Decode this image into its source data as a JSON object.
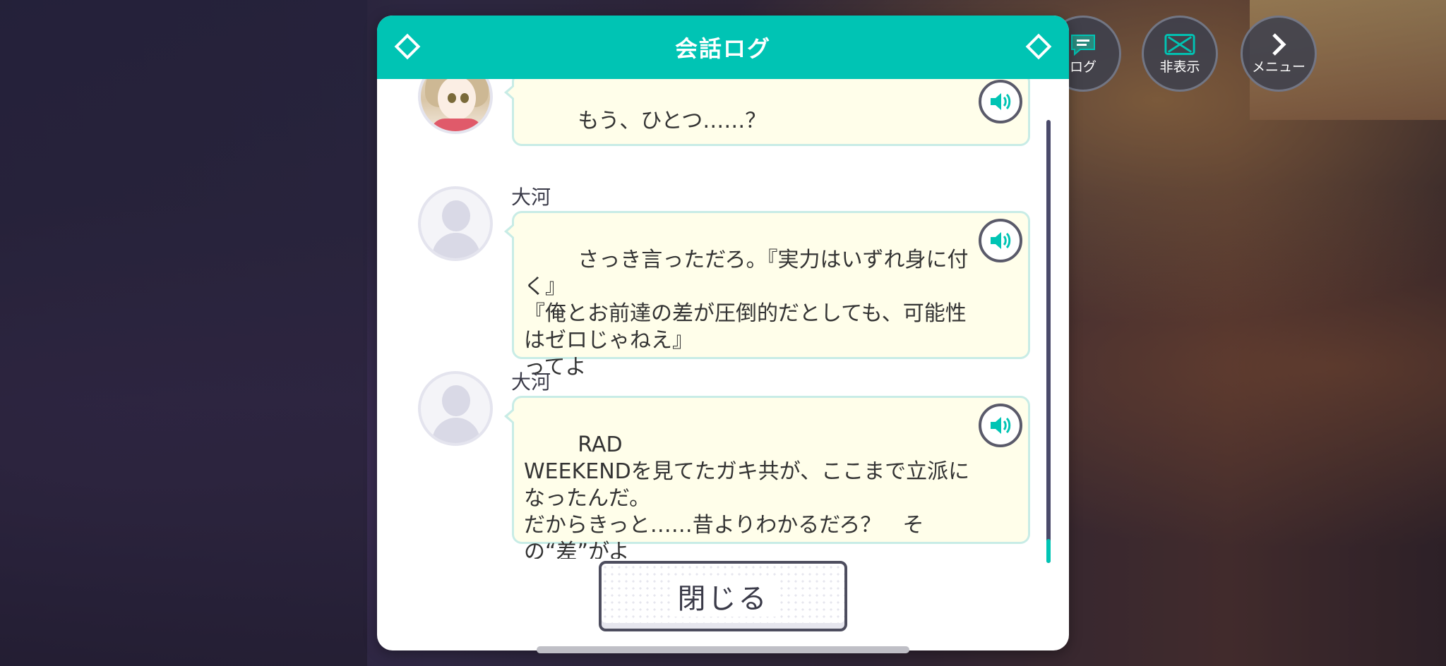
{
  "dialog": {
    "title": "会話ログ",
    "close_label": "閉じる"
  },
  "hud": {
    "log_label": "ログ",
    "hide_label": "非表示",
    "menu_label": "メニュー"
  },
  "entries": [
    {
      "speaker": "",
      "text": "もう、ひとつ……？",
      "avatar": "girl"
    },
    {
      "speaker": "大河",
      "text": "さっき言っただろ。『実力はいずれ身に付く』\n『俺とお前達の差が圧倒的だとしても、可能性はゼロじゃねえ』\nってよ",
      "avatar": "blank"
    },
    {
      "speaker": "大河",
      "text": "RAD\nWEEKENDを見てたガキ共が、ここまで立派になったんだ。\nだからきっと……昔よりわかるだろ？　その“差”がよ",
      "avatar": "blank"
    }
  ],
  "colors": {
    "accent": "#00c4b4",
    "bubble_bg": "#fffeea",
    "bubble_border": "#c8ece6"
  }
}
